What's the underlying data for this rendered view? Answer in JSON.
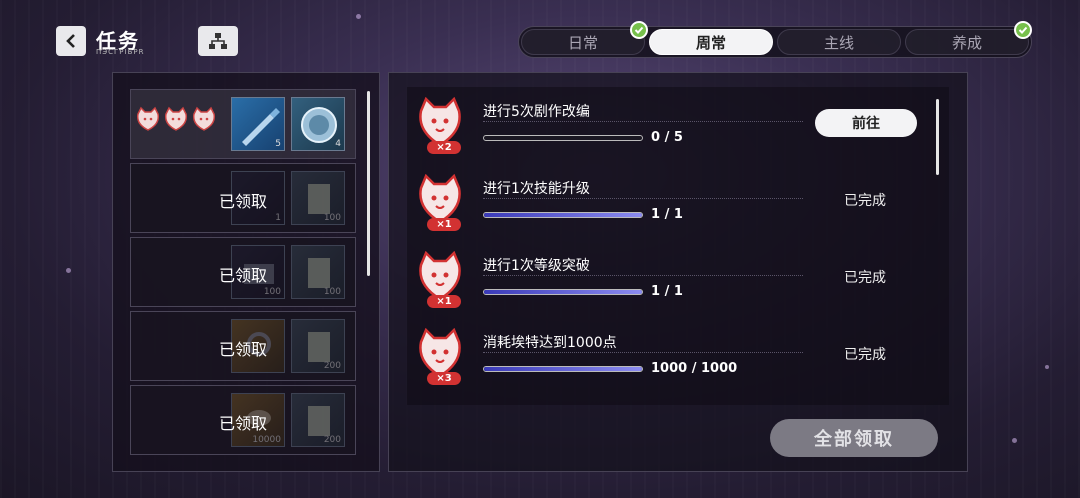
{
  "header": {
    "title": "任务",
    "subtitle": "ПЭСГРIБРR"
  },
  "tabs": [
    {
      "label": "日常",
      "active": false,
      "completed": true
    },
    {
      "label": "周常",
      "active": true,
      "completed": false
    },
    {
      "label": "主线",
      "active": false,
      "completed": false
    },
    {
      "label": "养成",
      "active": false,
      "completed": true
    }
  ],
  "rewards": {
    "row1": {
      "item1_qty": "5",
      "item2_qty": "4"
    },
    "row2": {
      "status": "已领取",
      "item1_qty": "1",
      "item2_qty": "100"
    },
    "row3": {
      "status": "已领取",
      "item1_qty": "100",
      "item2_qty": "100"
    },
    "row4": {
      "status": "已领取",
      "item1_qty": "",
      "item2_qty": "200"
    },
    "row5": {
      "status": "已领取",
      "item1_qty": "10000",
      "item2_qty": "200"
    }
  },
  "tasks": [
    {
      "name": "进行5次剧作改编",
      "multiplier": "×2",
      "progress_text": "0 / 5",
      "progress": 0.0,
      "action": "前往"
    },
    {
      "name": "进行1次技能升级",
      "multiplier": "×1",
      "progress_text": "1 / 1",
      "progress": 1.0,
      "status": "已完成"
    },
    {
      "name": "进行1次等级突破",
      "multiplier": "×1",
      "progress_text": "1 / 1",
      "progress": 1.0,
      "status": "已完成"
    },
    {
      "name": "消耗埃特达到1000点",
      "multiplier": "×3",
      "progress_text": "1000 / 1000",
      "progress": 1.0,
      "status": "已完成"
    }
  ],
  "footer": {
    "claim_all_label": "全部领取"
  },
  "colors": {
    "accent_check": "#77c04c",
    "badge_red": "#d23232",
    "progress_blue": "#5a5ad8"
  }
}
